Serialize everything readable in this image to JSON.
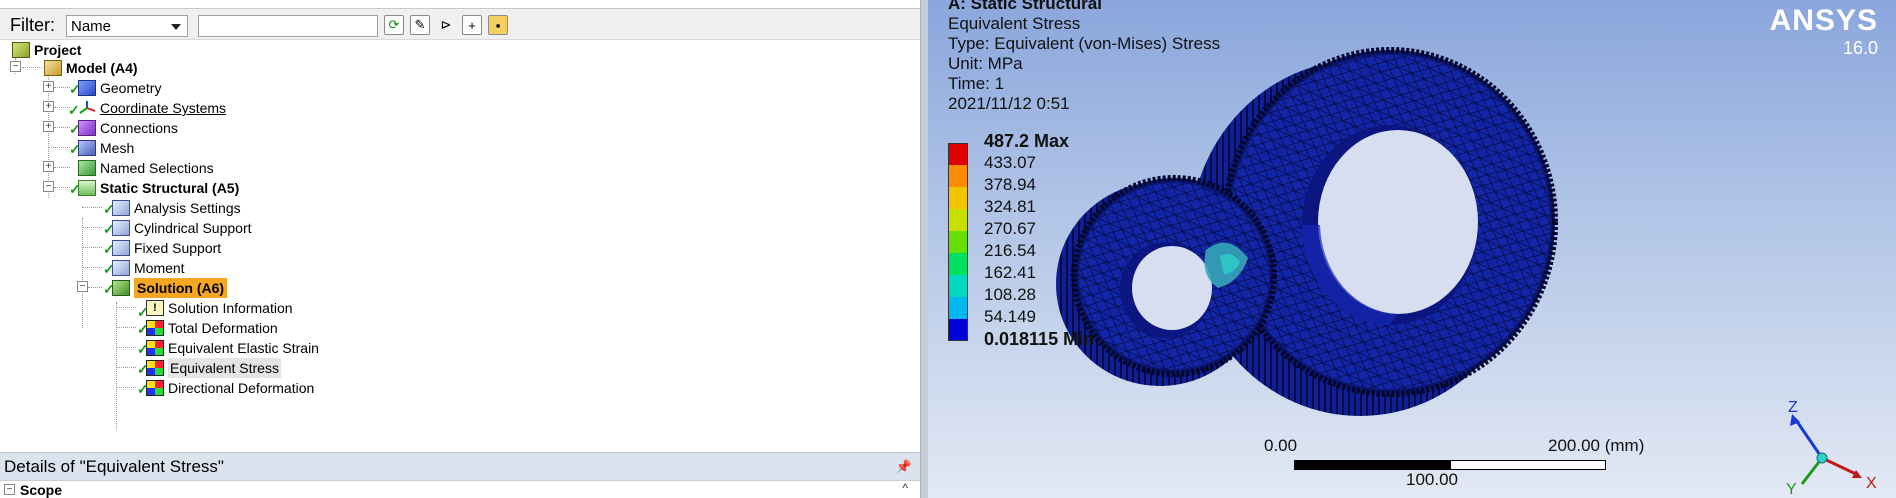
{
  "outline": {
    "filter_label": "Filter:",
    "filter_select_value": "Name",
    "filter_input_value": "",
    "tree": [
      {
        "label": "Project"
      },
      {
        "label": "Model (A4)"
      },
      {
        "label": "Geometry"
      },
      {
        "label": "Coordinate Systems"
      },
      {
        "label": "Connections"
      },
      {
        "label": "Mesh"
      },
      {
        "label": "Named Selections"
      },
      {
        "label": "Static Structural (A5)"
      },
      {
        "label": "Analysis Settings"
      },
      {
        "label": "Cylindrical Support"
      },
      {
        "label": "Fixed Support"
      },
      {
        "label": "Moment"
      },
      {
        "label": "Solution (A6)"
      },
      {
        "label": "Solution Information"
      },
      {
        "label": "Total Deformation"
      },
      {
        "label": "Equivalent Elastic Strain"
      },
      {
        "label": "Equivalent Stress"
      },
      {
        "label": "Directional Deformation"
      }
    ]
  },
  "details": {
    "title": "Details of \"Equivalent Stress\"",
    "section": "Scope"
  },
  "viewport": {
    "result_title": "A: Static Structural",
    "result_name": "Equivalent Stress",
    "type": "Type: Equivalent (von-Mises) Stress",
    "unit": "Unit: MPa",
    "time": "Time: 1",
    "date": "2021/11/12 0:51",
    "legend": [
      "487.2 Max",
      "433.07",
      "378.94",
      "324.81",
      "270.67",
      "216.54",
      "162.41",
      "108.28",
      "54.149",
      "0.018115 Min"
    ],
    "legend_colors": [
      "#e00000",
      "#ff8c00",
      "#f2c400",
      "#c8e000",
      "#66e000",
      "#00e060",
      "#00d8c0",
      "#00b8f0",
      "#0070f0",
      "#0000d8"
    ],
    "brand": "ANSYS",
    "version": "16.0",
    "scale_left": "0.00",
    "scale_right": "200.00 (mm)",
    "scale_mid": "100.00",
    "axis_z": "Z",
    "axis_x": "X",
    "axis_y": "Y"
  }
}
